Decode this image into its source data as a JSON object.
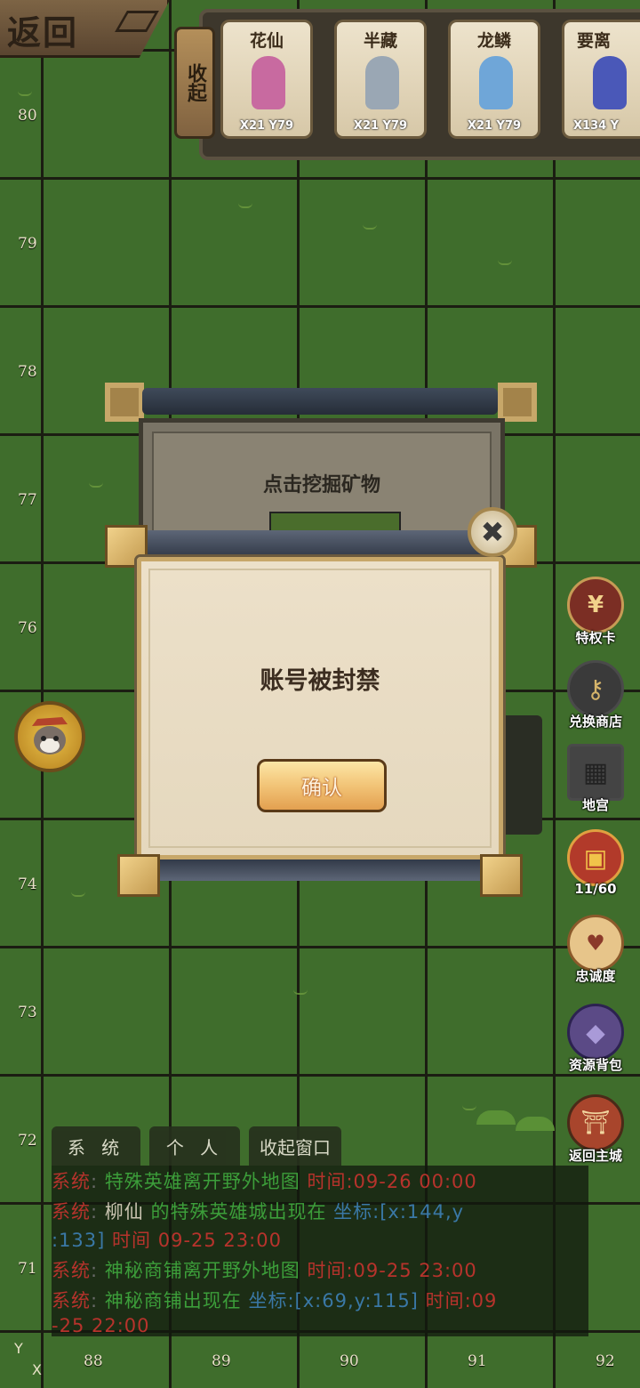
{
  "header": {
    "back_label": "返回",
    "collapse_label": "收起"
  },
  "heroes": [
    {
      "name": "花仙",
      "coord": "X21 Y79",
      "color": "#c86aa0"
    },
    {
      "name": "半藏",
      "coord": "X21 Y79",
      "color": "#9aa7b4"
    },
    {
      "name": "龙鳞",
      "coord": "X21 Y79",
      "color": "#6fa6d8"
    },
    {
      "name": "要离",
      "coord": "X134 Y",
      "color": "#4a58b8"
    }
  ],
  "map": {
    "y_labels": [
      "80",
      "79",
      "78",
      "77",
      "76",
      "74",
      "73",
      "72",
      "71"
    ],
    "x_labels": [
      "88",
      "89",
      "90",
      "91",
      "92"
    ],
    "axis_y": "Y",
    "axis_x": "X"
  },
  "back_panel": {
    "title": "点击挖掘矿物"
  },
  "dialog": {
    "message": "账号被封禁",
    "confirm_label": "确认",
    "close_symbol": "✖"
  },
  "side_menu": [
    {
      "label": "特权卡",
      "icon": "privilege-card-icon"
    },
    {
      "label": "兑换商店",
      "icon": "exchange-shop-icon"
    },
    {
      "label": "地宫",
      "icon": "dungeon-icon"
    },
    {
      "label": "11/60",
      "icon": "treasure-chest-icon"
    },
    {
      "label": "忠诚度",
      "icon": "loyalty-icon"
    },
    {
      "label": "资源背包",
      "icon": "resource-bag-icon"
    },
    {
      "label": "返回主城",
      "icon": "return-city-icon"
    }
  ],
  "chat": {
    "tabs": [
      "系 统",
      "个 人",
      "收起窗口"
    ],
    "lines": [
      {
        "prefix": "系统",
        "sep": ":",
        "body": "特殊英雄离开野外地图",
        "time_label": "时间",
        "time": ":09-26 00:00"
      },
      {
        "prefix": "系统",
        "sep": ":",
        "name": "柳仙",
        "body": "的特殊英雄城出现在",
        "coord_label": "坐标",
        "coord": ":[x:144,y",
        "coord_rest": ":133]",
        "time_label": "时间",
        "time": "09-25 23:00"
      },
      {
        "prefix": "系统",
        "sep": ":",
        "body": "神秘商铺离开野外地图",
        "time_label": "时间",
        "time": ":09-25 23:00"
      },
      {
        "prefix": "系统",
        "sep": ":",
        "body": "神秘商铺出现在",
        "coord_label": "坐标",
        "coord": ":[x:69,y:115]",
        "time_label": "时间",
        "time": ":09",
        "time_rest": "-25 22:00"
      }
    ]
  }
}
